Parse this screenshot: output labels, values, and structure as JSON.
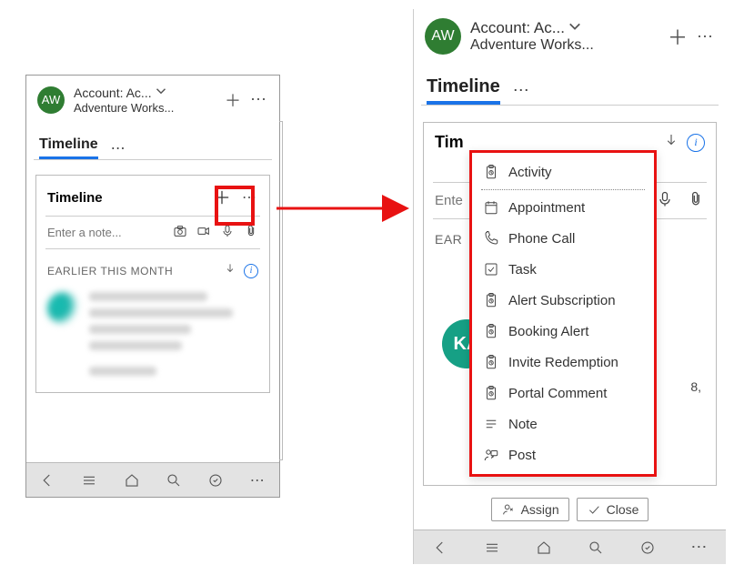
{
  "account": {
    "avatar_initials": "AW",
    "title_label": "Account: Ac...",
    "subtitle": "Adventure Works..."
  },
  "tabs": {
    "timeline": "Timeline"
  },
  "card": {
    "title": "Timeline",
    "note_placeholder": "Enter a note...",
    "section_label": "EARLIER THIS MONTH"
  },
  "right": {
    "ka_initials": "KA",
    "card_title_trunc": "Tim",
    "note_placeholder_trunc": "Ente",
    "section_label_trunc": "EAR",
    "peek_text": "8,"
  },
  "menu": {
    "items": [
      {
        "label": "Activity",
        "icon": "clipboard"
      },
      {
        "label": "Appointment",
        "icon": "calendar"
      },
      {
        "label": "Phone Call",
        "icon": "phone"
      },
      {
        "label": "Task",
        "icon": "checkbox"
      },
      {
        "label": "Alert Subscription",
        "icon": "clipboard"
      },
      {
        "label": "Booking Alert",
        "icon": "clipboard"
      },
      {
        "label": "Invite Redemption",
        "icon": "clipboard"
      },
      {
        "label": "Portal Comment",
        "icon": "clipboard"
      },
      {
        "label": "Note",
        "icon": "note"
      },
      {
        "label": "Post",
        "icon": "post"
      }
    ]
  },
  "pills": {
    "assign": "Assign",
    "close": "Close"
  }
}
